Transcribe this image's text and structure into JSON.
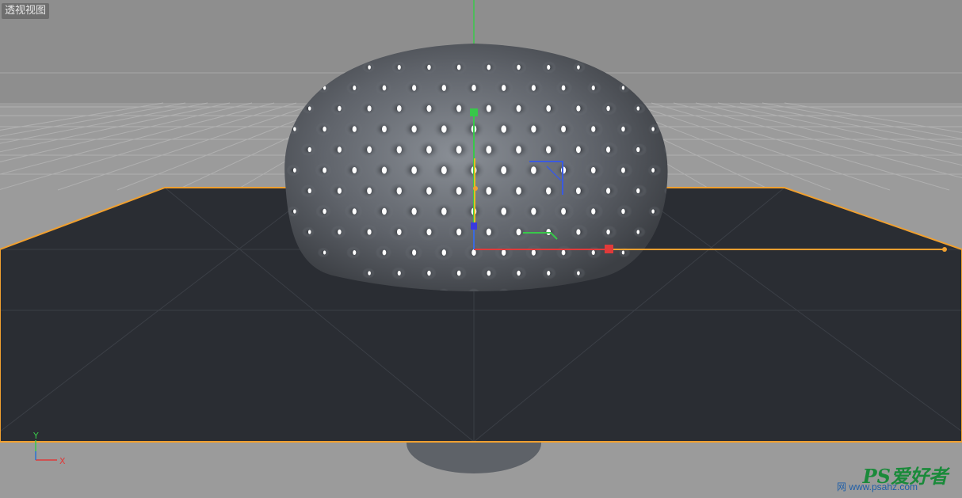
{
  "viewport": {
    "label": "透视视图",
    "background": "#9a9a9a",
    "floor_color": "#2a2d33",
    "selection_color": "#f0a030"
  },
  "axis_widget": {
    "y_label": "Y",
    "x_label": "X",
    "y_color": "#38c84a",
    "x_color": "#e03a3a",
    "z_color": "#3a6ae0"
  },
  "object": {
    "name": "perforated-dome",
    "color": "#6a6e74"
  },
  "watermark": {
    "logo": "PS爱好者",
    "site": "网 www.psahz.com"
  }
}
